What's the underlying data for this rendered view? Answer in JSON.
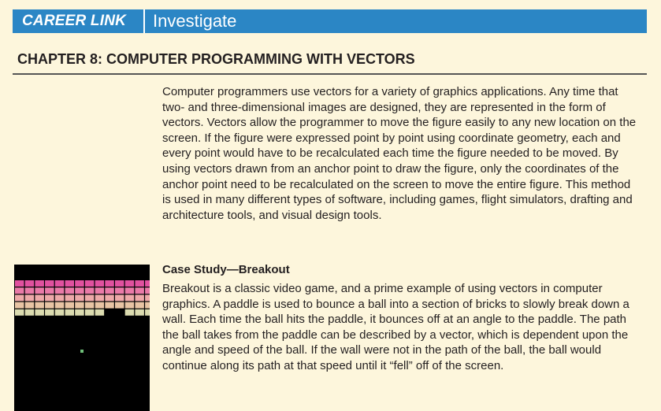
{
  "banner": {
    "tag": "CAREER LINK",
    "title": "Investigate"
  },
  "chapter": {
    "title": "CHAPTER 8: COMPUTER PROGRAMMING WITH VECTORS"
  },
  "intro": {
    "text": "Computer programmers use vectors for a variety of graphics applications. Any time that two- and three-dimensional images are designed, they are represented in the form of vectors. Vectors allow the programmer to move the figure easily to any new location on the screen. If the figure were expressed point by point using coordinate geometry, each and every point would have to be recalculated each time the figure needed to be moved. By using vectors drawn from an anchor point to draw the figure, only the coordinates of the anchor point need to be recalculated on the screen to move the entire figure. This method is used in many different types of software, including games, flight simulators, drafting and architecture tools, and visual design tools."
  },
  "case_study": {
    "title": "Case Study—Breakout",
    "text": "Breakout is a classic video game, and a prime example of using vectors in computer graphics. A paddle is used to bounce a ball into a section of bricks to slowly break down a wall. Each time the ball hits the paddle, it bounces off at an angle to the paddle. The path the ball takes from the paddle can be described by a vector, which is dependent upon the angle and speed of the ball. If the wall were not in the path of the ball, the ball would continue along its path at that speed until it “fell” off of the screen."
  },
  "colors": {
    "banner": "#2b86c5",
    "page_background": "#fdf6dc",
    "brick_rows": [
      "#e0519f",
      "#e97aa8",
      "#eea9a9",
      "#e8c4a4",
      "#dcdcb0"
    ],
    "ball": "#6fc07a",
    "game_background": "#000000"
  }
}
